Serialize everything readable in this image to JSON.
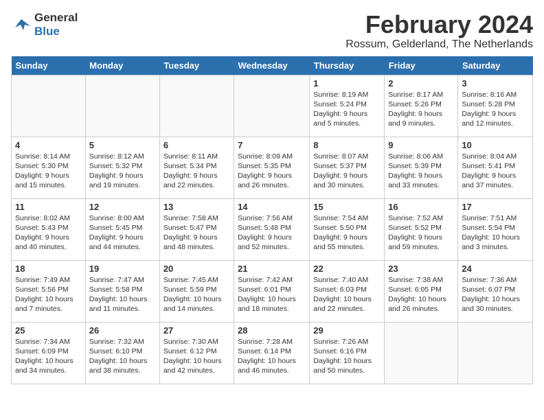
{
  "header": {
    "logo_line1": "General",
    "logo_line2": "Blue",
    "month_year": "February 2024",
    "location": "Rossum, Gelderland, The Netherlands"
  },
  "weekdays": [
    "Sunday",
    "Monday",
    "Tuesday",
    "Wednesday",
    "Thursday",
    "Friday",
    "Saturday"
  ],
  "weeks": [
    [
      {
        "day": "",
        "info": ""
      },
      {
        "day": "",
        "info": ""
      },
      {
        "day": "",
        "info": ""
      },
      {
        "day": "",
        "info": ""
      },
      {
        "day": "1",
        "info": "Sunrise: 8:19 AM\nSunset: 5:24 PM\nDaylight: 9 hours\nand 5 minutes."
      },
      {
        "day": "2",
        "info": "Sunrise: 8:17 AM\nSunset: 5:26 PM\nDaylight: 9 hours\nand 9 minutes."
      },
      {
        "day": "3",
        "info": "Sunrise: 8:16 AM\nSunset: 5:28 PM\nDaylight: 9 hours\nand 12 minutes."
      }
    ],
    [
      {
        "day": "4",
        "info": "Sunrise: 8:14 AM\nSunset: 5:30 PM\nDaylight: 9 hours\nand 15 minutes."
      },
      {
        "day": "5",
        "info": "Sunrise: 8:12 AM\nSunset: 5:32 PM\nDaylight: 9 hours\nand 19 minutes."
      },
      {
        "day": "6",
        "info": "Sunrise: 8:11 AM\nSunset: 5:34 PM\nDaylight: 9 hours\nand 22 minutes."
      },
      {
        "day": "7",
        "info": "Sunrise: 8:09 AM\nSunset: 5:35 PM\nDaylight: 9 hours\nand 26 minutes."
      },
      {
        "day": "8",
        "info": "Sunrise: 8:07 AM\nSunset: 5:37 PM\nDaylight: 9 hours\nand 30 minutes."
      },
      {
        "day": "9",
        "info": "Sunrise: 8:06 AM\nSunset: 5:39 PM\nDaylight: 9 hours\nand 33 minutes."
      },
      {
        "day": "10",
        "info": "Sunrise: 8:04 AM\nSunset: 5:41 PM\nDaylight: 9 hours\nand 37 minutes."
      }
    ],
    [
      {
        "day": "11",
        "info": "Sunrise: 8:02 AM\nSunset: 5:43 PM\nDaylight: 9 hours\nand 40 minutes."
      },
      {
        "day": "12",
        "info": "Sunrise: 8:00 AM\nSunset: 5:45 PM\nDaylight: 9 hours\nand 44 minutes."
      },
      {
        "day": "13",
        "info": "Sunrise: 7:58 AM\nSunset: 5:47 PM\nDaylight: 9 hours\nand 48 minutes."
      },
      {
        "day": "14",
        "info": "Sunrise: 7:56 AM\nSunset: 5:48 PM\nDaylight: 9 hours\nand 52 minutes."
      },
      {
        "day": "15",
        "info": "Sunrise: 7:54 AM\nSunset: 5:50 PM\nDaylight: 9 hours\nand 55 minutes."
      },
      {
        "day": "16",
        "info": "Sunrise: 7:52 AM\nSunset: 5:52 PM\nDaylight: 9 hours\nand 59 minutes."
      },
      {
        "day": "17",
        "info": "Sunrise: 7:51 AM\nSunset: 5:54 PM\nDaylight: 10 hours\nand 3 minutes."
      }
    ],
    [
      {
        "day": "18",
        "info": "Sunrise: 7:49 AM\nSunset: 5:56 PM\nDaylight: 10 hours\nand 7 minutes."
      },
      {
        "day": "19",
        "info": "Sunrise: 7:47 AM\nSunset: 5:58 PM\nDaylight: 10 hours\nand 11 minutes."
      },
      {
        "day": "20",
        "info": "Sunrise: 7:45 AM\nSunset: 5:59 PM\nDaylight: 10 hours\nand 14 minutes."
      },
      {
        "day": "21",
        "info": "Sunrise: 7:42 AM\nSunset: 6:01 PM\nDaylight: 10 hours\nand 18 minutes."
      },
      {
        "day": "22",
        "info": "Sunrise: 7:40 AM\nSunset: 6:03 PM\nDaylight: 10 hours\nand 22 minutes."
      },
      {
        "day": "23",
        "info": "Sunrise: 7:38 AM\nSunset: 6:05 PM\nDaylight: 10 hours\nand 26 minutes."
      },
      {
        "day": "24",
        "info": "Sunrise: 7:36 AM\nSunset: 6:07 PM\nDaylight: 10 hours\nand 30 minutes."
      }
    ],
    [
      {
        "day": "25",
        "info": "Sunrise: 7:34 AM\nSunset: 6:09 PM\nDaylight: 10 hours\nand 34 minutes."
      },
      {
        "day": "26",
        "info": "Sunrise: 7:32 AM\nSunset: 6:10 PM\nDaylight: 10 hours\nand 38 minutes."
      },
      {
        "day": "27",
        "info": "Sunrise: 7:30 AM\nSunset: 6:12 PM\nDaylight: 10 hours\nand 42 minutes."
      },
      {
        "day": "28",
        "info": "Sunrise: 7:28 AM\nSunset: 6:14 PM\nDaylight: 10 hours\nand 46 minutes."
      },
      {
        "day": "29",
        "info": "Sunrise: 7:26 AM\nSunset: 6:16 PM\nDaylight: 10 hours\nand 50 minutes."
      },
      {
        "day": "",
        "info": ""
      },
      {
        "day": "",
        "info": ""
      }
    ]
  ]
}
